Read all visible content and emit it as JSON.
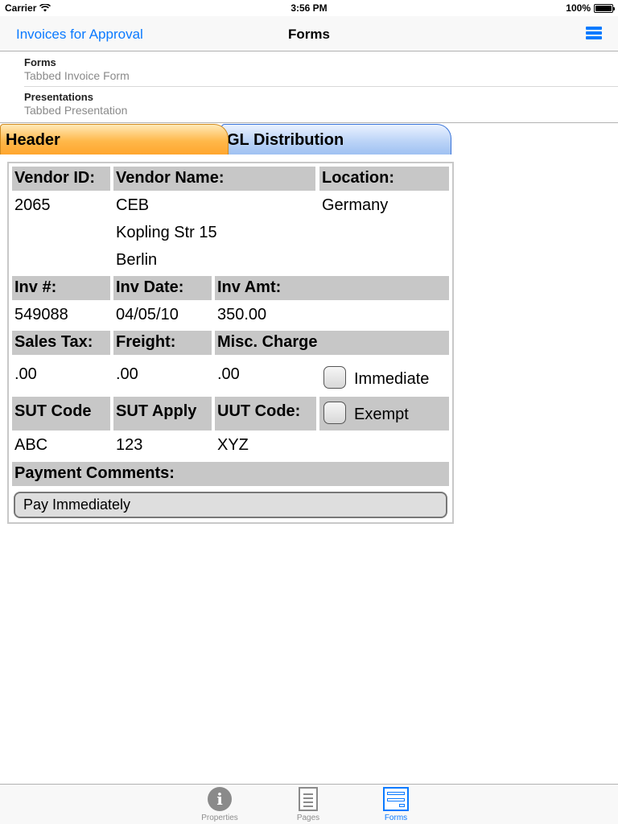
{
  "status_bar": {
    "carrier": "Carrier",
    "time": "3:56 PM",
    "battery": "100%"
  },
  "nav": {
    "back_label": "Invoices for Approval",
    "title": "Forms",
    "menu_icon": "list-icon"
  },
  "info": [
    {
      "label": "Forms",
      "value": "Tabbed Invoice Form"
    },
    {
      "label": "Presentations",
      "value": "Tabbed Presentation"
    }
  ],
  "tabs": [
    {
      "label": "Header",
      "active": true,
      "color": "#ffb84a"
    },
    {
      "label": "GL Distribution",
      "active": false,
      "color": "#bcd4f7"
    }
  ],
  "form": {
    "vendor_id_label": "Vendor ID:",
    "vendor_name_label": "Vendor Name:",
    "location_label": "Location:",
    "vendor_id": "2065",
    "vendor_name": "CEB",
    "vendor_street": "Kopling Str 15",
    "vendor_city": "Berlin",
    "location": "Germany",
    "inv_no_label": "Inv #:",
    "inv_date_label": "Inv Date:",
    "inv_amt_label": "Inv Amt:",
    "inv_no": "549088",
    "inv_date": "04/05/10",
    "inv_amt": "350.00",
    "sales_tax_label": "Sales Tax:",
    "freight_label": "Freight:",
    "misc_charge_label": "Misc. Charge",
    "sales_tax": ".00",
    "freight": ".00",
    "misc_charge": ".00",
    "immediate_label": "Immediate",
    "sut_code_label": "SUT Code",
    "sut_apply_label": "SUT Apply",
    "uut_code_label": "UUT Code:",
    "exempt_label": "Exempt",
    "sut_code": "ABC",
    "sut_apply": "123",
    "uut_code": "XYZ",
    "payment_comments_label": "Payment Comments:",
    "payment_comments": "Pay Immediately"
  },
  "tab_bar": [
    {
      "label": "Properties",
      "icon": "info-icon",
      "active": false
    },
    {
      "label": "Pages",
      "icon": "pages-icon",
      "active": false
    },
    {
      "label": "Forms",
      "icon": "forms-icon",
      "active": true
    }
  ],
  "colors": {
    "accent": "#0a7aff",
    "header_cell": "#c7c7c7"
  }
}
